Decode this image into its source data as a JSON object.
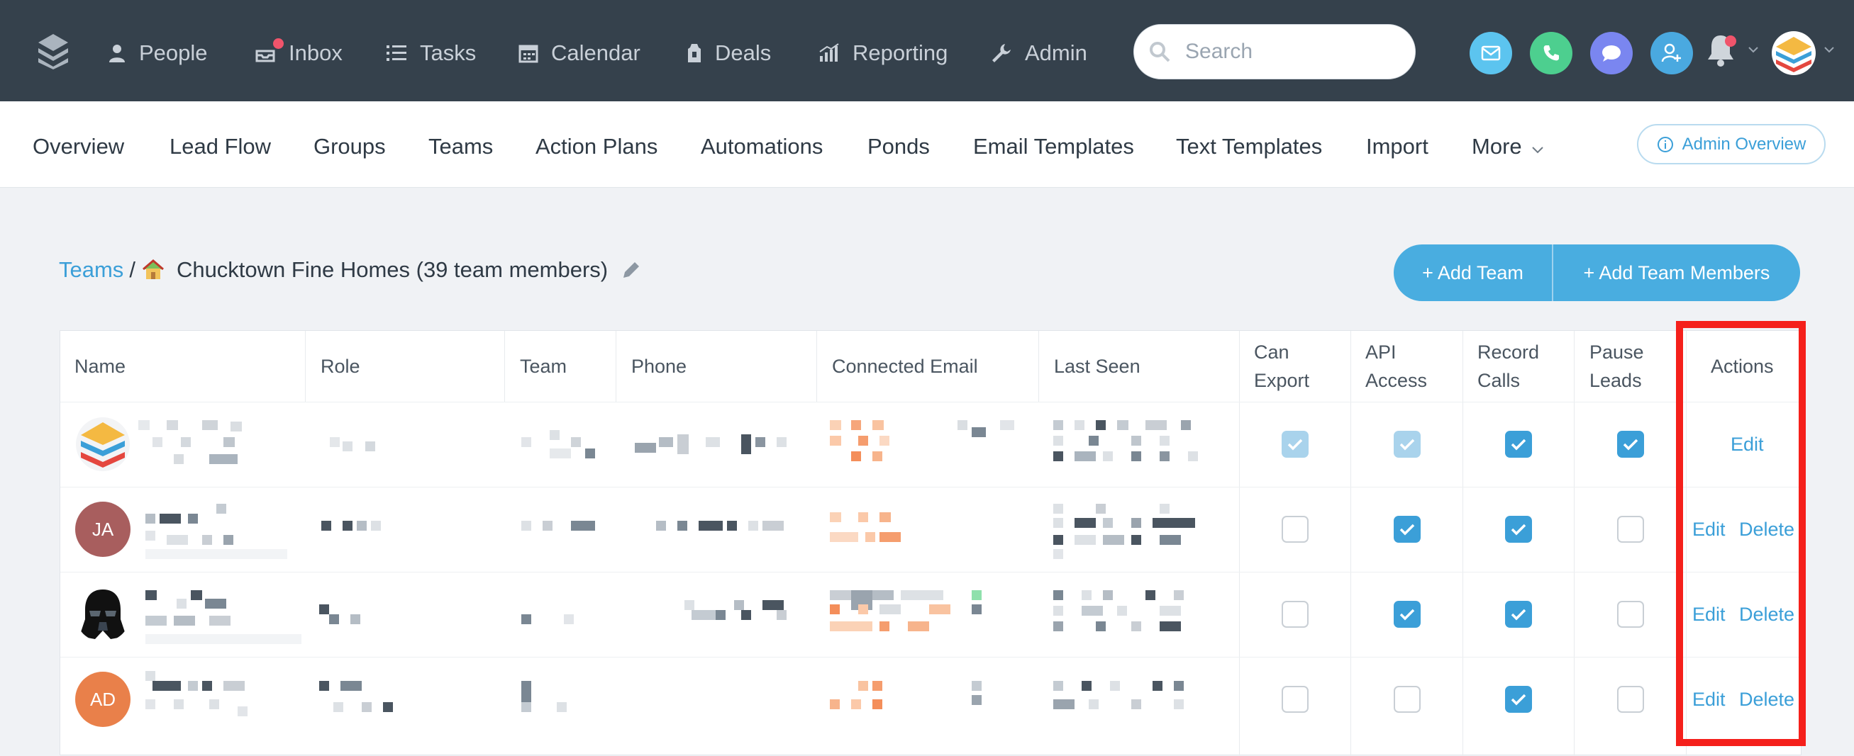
{
  "topnav": {
    "items": [
      {
        "label": "People",
        "icon": "person-icon"
      },
      {
        "label": "Inbox",
        "icon": "inbox-icon"
      },
      {
        "label": "Tasks",
        "icon": "tasks-icon"
      },
      {
        "label": "Calendar",
        "icon": "calendar-icon"
      },
      {
        "label": "Deals",
        "icon": "deals-icon"
      },
      {
        "label": "Reporting",
        "icon": "reporting-icon"
      },
      {
        "label": "Admin",
        "icon": "wrench-icon"
      }
    ],
    "search_placeholder": "Search",
    "quick_actions": [
      {
        "name": "email",
        "color": "#5cc4ef"
      },
      {
        "name": "call",
        "color": "#4dcf8f"
      },
      {
        "name": "text",
        "color": "#7a86f0"
      },
      {
        "name": "add-person",
        "color": "#4aa9e0"
      }
    ]
  },
  "subnav": {
    "items": [
      "Overview",
      "Lead Flow",
      "Groups",
      "Teams",
      "Action Plans",
      "Automations",
      "Ponds",
      "Email Templates",
      "Text Templates",
      "Import",
      "More"
    ],
    "admin_overview": "Admin Overview"
  },
  "breadcrumb": {
    "root": "Teams",
    "separator": "/",
    "team_name": "Chucktown Fine Homes (39 team members)"
  },
  "buttons": {
    "add_team": "+ Add Team",
    "add_team_members": "+ Add Team Members"
  },
  "table": {
    "headers": {
      "name": "Name",
      "role": "Role",
      "team": "Team",
      "phone": "Phone",
      "connected_email": "Connected Email",
      "last_seen": "Last Seen",
      "can_export": [
        "Can",
        "Export"
      ],
      "api_access": [
        "API",
        "Access"
      ],
      "record_calls": [
        "Record",
        "Calls"
      ],
      "pause_leads": [
        "Pause",
        "Leads"
      ],
      "actions": "Actions"
    },
    "rows": [
      {
        "avatar": "logo",
        "can_export": "checked-disabled",
        "api_access": "checked-disabled",
        "record_calls": true,
        "pause_leads": true,
        "actions": [
          "Edit"
        ]
      },
      {
        "avatar": "JA",
        "avatar_color": "#a85e5e",
        "can_export": false,
        "api_access": true,
        "record_calls": true,
        "pause_leads": false,
        "actions": [
          "Edit",
          "Delete"
        ]
      },
      {
        "avatar": "darth-vader",
        "can_export": false,
        "api_access": true,
        "record_calls": true,
        "pause_leads": false,
        "actions": [
          "Edit",
          "Delete"
        ]
      },
      {
        "avatar": "AD",
        "avatar_color": "#e9804a",
        "can_export": false,
        "api_access": false,
        "record_calls": true,
        "pause_leads": false,
        "actions": [
          "Edit",
          "Delete"
        ]
      }
    ]
  },
  "colors": {
    "topnav_bg": "#35414c",
    "accent": "#3b9fd8",
    "highlight": "#f5201b"
  }
}
